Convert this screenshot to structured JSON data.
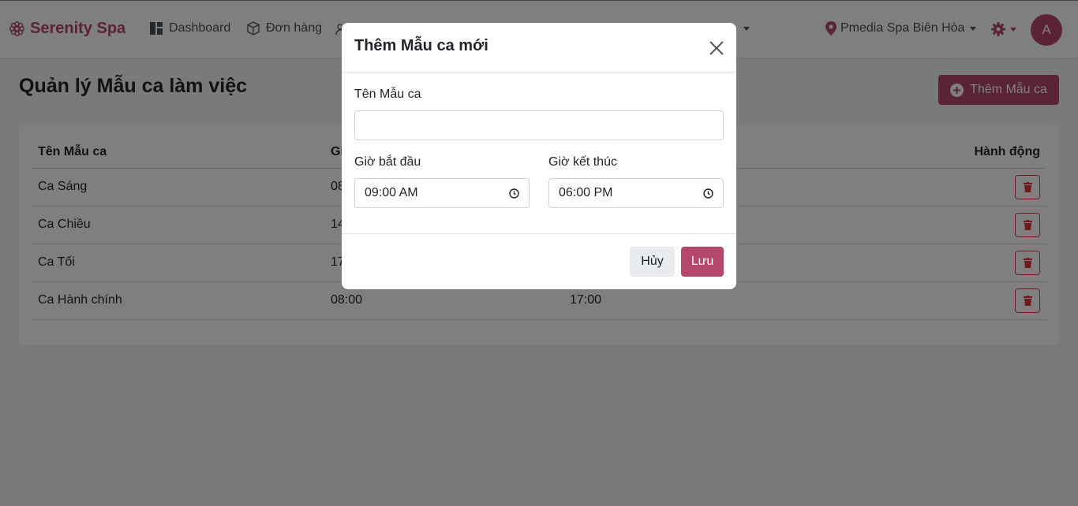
{
  "colors": {
    "brand": "#b4476e",
    "danger": "#dc3545"
  },
  "navbar": {
    "brand": "Serenity Spa",
    "items": [
      {
        "label": "Dashboard",
        "icon": "dashboard-icon"
      },
      {
        "label": "Đơn hàng",
        "icon": "box-icon"
      }
    ],
    "branch": "Pmedia Spa Biên Hòa",
    "avatar": "A"
  },
  "page": {
    "title": "Quản lý Mẫu ca làm việc",
    "add_button": "Thêm Mẫu ca"
  },
  "table": {
    "headers": [
      "Tên Mẫu ca",
      "Gi",
      "",
      "Hành động"
    ],
    "rows": [
      [
        "Ca Sáng",
        "08",
        ""
      ],
      [
        "Ca Chiều",
        "14",
        ""
      ],
      [
        "Ca Tối",
        "17",
        ""
      ],
      [
        "Ca Hành chính",
        "08:00",
        "17:00"
      ]
    ]
  },
  "modal": {
    "title": "Thêm Mẫu ca mới",
    "name_label": "Tên Mẫu ca",
    "name_value": "",
    "start_label": "Giờ bắt đầu",
    "start_value": "09:00 AM",
    "end_label": "Giờ kết thúc",
    "end_value": "06:00 PM",
    "cancel": "Hủy",
    "save": "Lưu"
  }
}
